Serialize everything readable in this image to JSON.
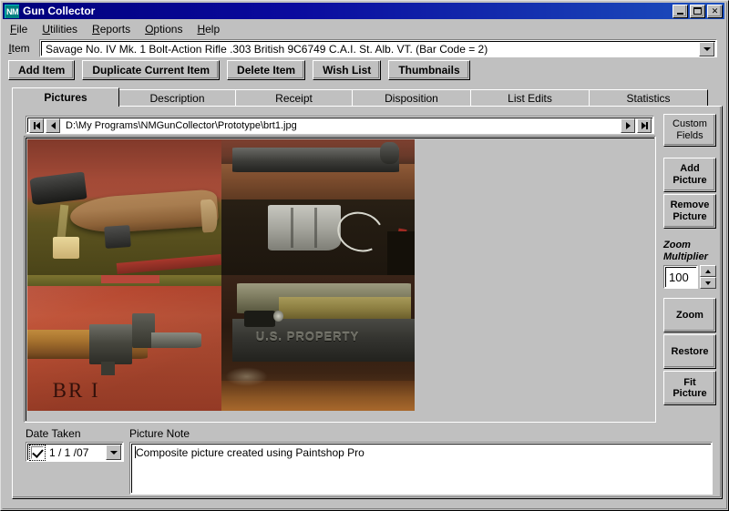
{
  "window": {
    "title": "Gun Collector",
    "icon_text": "NM",
    "buttons": {
      "minimize": "minimize-button",
      "maximize": "maximize-button",
      "close": "✕"
    }
  },
  "menu": [
    {
      "label": "File",
      "accel": "F"
    },
    {
      "label": "Utilities",
      "accel": "U"
    },
    {
      "label": "Reports",
      "accel": "R"
    },
    {
      "label": "Options",
      "accel": "O"
    },
    {
      "label": "Help",
      "accel": "H"
    }
  ],
  "item_selector": {
    "label": "Item",
    "accel": "I",
    "value": "Savage No. IV Mk. 1 Bolt-Action Rifle .303 British 9C6749 C.A.I. St. Alb. VT. (Bar Code = 2)"
  },
  "toolbar": [
    {
      "label": "Add Item"
    },
    {
      "label": "Duplicate Current Item"
    },
    {
      "label": "Delete Item"
    },
    {
      "label": "Wish List"
    },
    {
      "label": "Thumbnails"
    }
  ],
  "tabs": [
    {
      "label": "Pictures",
      "active": true
    },
    {
      "label": "Description",
      "active": false
    },
    {
      "label": "Receipt",
      "active": false
    },
    {
      "label": "Disposition",
      "active": false
    },
    {
      "label": "List Edits",
      "active": false
    },
    {
      "label": "Statistics",
      "active": false
    }
  ],
  "picture_panel": {
    "path": "D:\\My Programs\\NMGunCollector\\Prototype\\brt1.jpg",
    "nav": {
      "first": "first-record",
      "previous": "previous-record",
      "next": "next-record",
      "last": "last-record"
    },
    "image_alt": "Composite of four rifle photographs",
    "quadrant_labels": {
      "bottom_left_watermark": "BR I",
      "bottom_right_stamp": "U.S. PROPERTY"
    }
  },
  "sidebar": {
    "custom_fields": "Custom\nFields",
    "custom_fields_l1": "Custom",
    "custom_fields_l2": "Fields",
    "add_picture_l1": "Add",
    "add_picture_l2": "Picture",
    "remove_picture_l1": "Remove",
    "remove_picture_l2": "Picture",
    "zoom_label_l1": "Zoom",
    "zoom_label_l2": "Multiplier",
    "zoom_value": "100",
    "zoom_button": "Zoom",
    "restore_button": "Restore",
    "fit_picture_l1": "Fit",
    "fit_picture_l2": "Picture"
  },
  "date_taken": {
    "label": "Date Taken",
    "checked": true,
    "value": "1 / 1 /07"
  },
  "picture_note": {
    "label": "Picture Note",
    "value": "Composite picture created using Paintshop Pro"
  },
  "colors": {
    "face": "#c0c0c0",
    "title_start": "#00007b",
    "title_end": "#1c4fbd",
    "icon_bg": "#008080",
    "field_bg": "#ffffff"
  }
}
